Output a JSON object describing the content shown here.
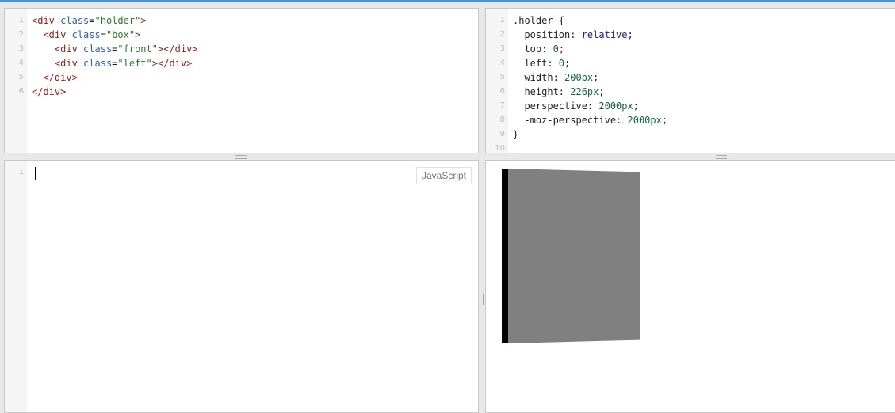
{
  "html_editor": {
    "lines": [
      {
        "n": "1",
        "segments": [
          [
            "tag",
            "<div"
          ],
          [
            "plain",
            " "
          ],
          [
            "attr",
            "class"
          ],
          [
            "plain",
            "="
          ],
          [
            "str",
            "\"holder\""
          ],
          [
            "tag",
            ">"
          ]
        ]
      },
      {
        "n": "2",
        "segments": [
          [
            "plain",
            "  "
          ],
          [
            "tag",
            "<div"
          ],
          [
            "plain",
            " "
          ],
          [
            "attr",
            "class"
          ],
          [
            "plain",
            "="
          ],
          [
            "str",
            "\"box\""
          ],
          [
            "tag",
            ">"
          ]
        ]
      },
      {
        "n": "3",
        "segments": [
          [
            "plain",
            "    "
          ],
          [
            "tag",
            "<div"
          ],
          [
            "plain",
            " "
          ],
          [
            "attr",
            "class"
          ],
          [
            "plain",
            "="
          ],
          [
            "str",
            "\"front\""
          ],
          [
            "tag",
            "></div>"
          ]
        ]
      },
      {
        "n": "4",
        "segments": [
          [
            "plain",
            "    "
          ],
          [
            "tag",
            "<div"
          ],
          [
            "plain",
            " "
          ],
          [
            "attr",
            "class"
          ],
          [
            "plain",
            "="
          ],
          [
            "str",
            "\"left\""
          ],
          [
            "tag",
            "></div>"
          ]
        ]
      },
      {
        "n": "5",
        "segments": [
          [
            "plain",
            "  "
          ],
          [
            "tag",
            "</div>"
          ]
        ]
      },
      {
        "n": "6",
        "segments": [
          [
            "tag",
            "</div>"
          ]
        ]
      }
    ]
  },
  "css_editor": {
    "lines": [
      {
        "n": "1",
        "segments": [
          [
            "plain",
            ".holder {"
          ]
        ]
      },
      {
        "n": "2",
        "segments": [
          [
            "plain",
            "  position: "
          ],
          [
            "kw",
            "relative"
          ],
          [
            "plain",
            ";"
          ]
        ]
      },
      {
        "n": "3",
        "segments": [
          [
            "plain",
            "  top: "
          ],
          [
            "num",
            "0"
          ],
          [
            "plain",
            ";"
          ]
        ]
      },
      {
        "n": "4",
        "segments": [
          [
            "plain",
            "  left: "
          ],
          [
            "num",
            "0"
          ],
          [
            "plain",
            ";"
          ]
        ]
      },
      {
        "n": "5",
        "segments": [
          [
            "plain",
            "  width: "
          ],
          [
            "num",
            "200px"
          ],
          [
            "plain",
            ";"
          ]
        ]
      },
      {
        "n": "6",
        "segments": [
          [
            "plain",
            "  height: "
          ],
          [
            "num",
            "226px"
          ],
          [
            "plain",
            ";"
          ]
        ]
      },
      {
        "n": "7",
        "segments": [
          [
            "plain",
            "  perspective: "
          ],
          [
            "num",
            "2000px"
          ],
          [
            "plain",
            ";"
          ]
        ]
      },
      {
        "n": "8",
        "segments": [
          [
            "plain",
            "  -moz-perspective: "
          ],
          [
            "num",
            "2000px"
          ],
          [
            "plain",
            ";"
          ]
        ]
      },
      {
        "n": "9",
        "segments": [
          [
            "plain",
            "}"
          ]
        ]
      },
      {
        "n": "10",
        "segments": []
      }
    ]
  },
  "js_editor": {
    "lines": [
      {
        "n": "1",
        "segments": []
      }
    ],
    "language_label": "JavaScript"
  },
  "result_panel": {
    "front_color": "#808080",
    "left_color": "#000000"
  }
}
